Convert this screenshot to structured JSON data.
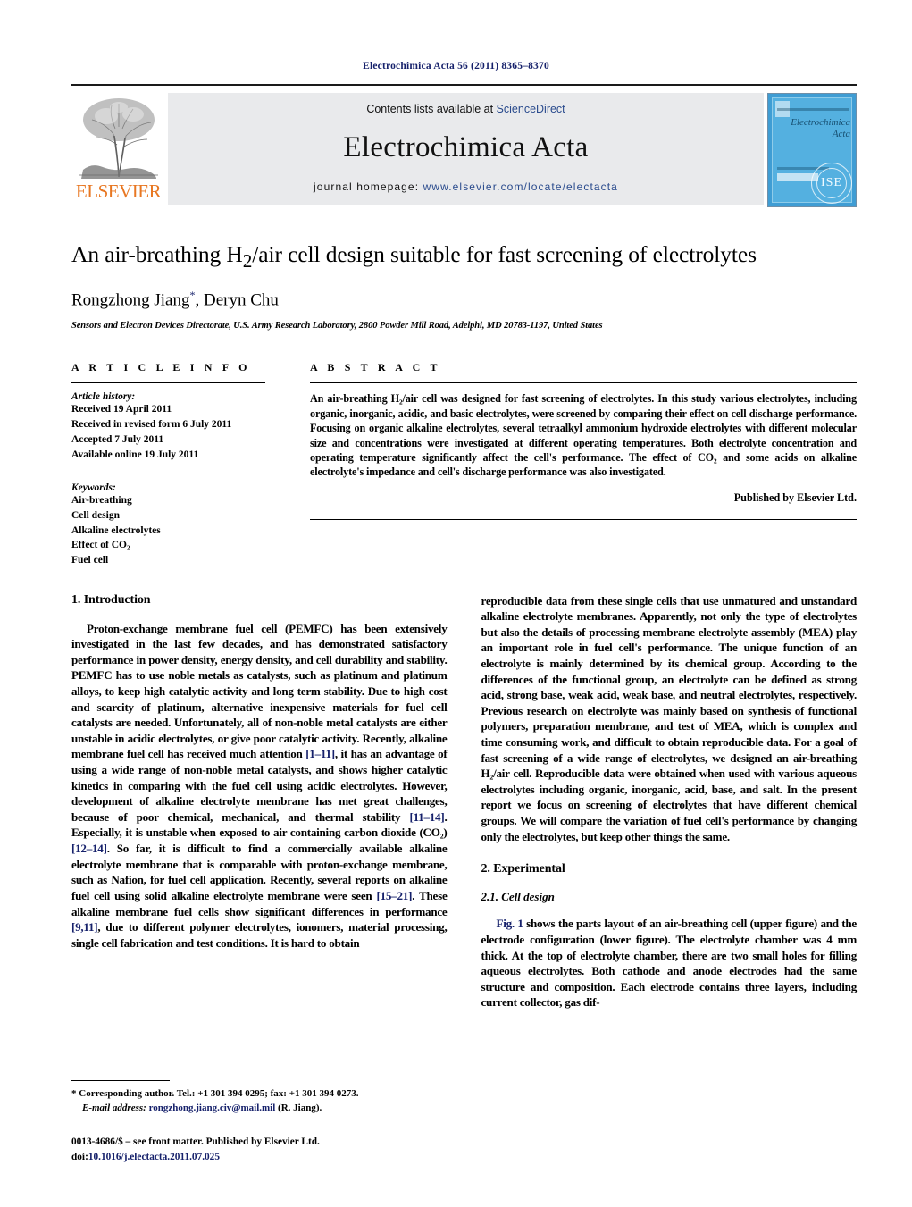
{
  "running_head": "Electrochimica Acta 56 (2011) 8365–8370",
  "masthead": {
    "publisher_name": "ELSEVIER",
    "contents_prefix": "Contents lists available at ",
    "contents_link": "ScienceDirect",
    "journal_name": "Electrochimica Acta",
    "homepage_prefix": "journal homepage: ",
    "homepage_url": "www.elsevier.com/locate/electacta",
    "cover_title": "Electrochimica Acta",
    "cover_seal_text": "ISE"
  },
  "article": {
    "title_part1": "An air-breathing H",
    "title_sub": "2",
    "title_part2": "/air cell design suitable for fast screening of electrolytes",
    "authors": "Rongzhong Jiang",
    "authors_sep": ", Deryn Chu",
    "corresponding_marker": "*",
    "affiliation": "Sensors and Electron Devices Directorate, U.S. Army Research Laboratory, 2800 Powder Mill Road, Adelphi, MD 20783-1197, United States"
  },
  "article_info": {
    "heading": "A R T I C L E    I N F O",
    "history_label": "Article history:",
    "history": [
      "Received 19 April 2011",
      "Received in revised form 6 July 2011",
      "Accepted 7 July 2011",
      "Available online 19 July 2011"
    ],
    "keywords_label": "Keywords:",
    "keywords": [
      "Air-breathing",
      "Cell design",
      "Alkaline electrolytes",
      "Effect of CO₂",
      "Fuel cell"
    ]
  },
  "abstract": {
    "heading": "A B S T R A C T",
    "text": "An air-breathing H₂/air cell was designed for fast screening of electrolytes. In this study various electrolytes, including organic, inorganic, acidic, and basic electrolytes, were screened by comparing their effect on cell discharge performance. Focusing on organic alkaline electrolytes, several tetraalkyl ammonium hydroxide electrolytes with different molecular size and concentrations were investigated at different operating temperatures. Both electrolyte concentration and operating temperature significantly affect the cell's performance. The effect of CO₂ and some acids on alkaline electrolyte's impedance and cell's discharge performance was also investigated.",
    "published_by": "Published by Elsevier Ltd."
  },
  "body": {
    "intro_heading": "1.  Introduction",
    "intro_p1_a": "Proton-exchange membrane fuel cell (PEMFC) has been extensively investigated in the last few decades, and has demonstrated satisfactory performance in power density, energy density, and cell durability and stability. PEMFC has to use noble metals as catalysts, such as platinum and platinum alloys, to keep high catalytic activity and long term stability. Due to high cost and scarcity of platinum, alternative inexpensive materials for fuel cell catalysts are needed. Unfortunately, all of non-noble metal catalysts are either unstable in acidic electrolytes, or give poor catalytic activity. Recently, alkaline membrane fuel cell has received much attention ",
    "ref1": "[1–11]",
    "intro_p1_b": ", it has an advantage of using a wide range of non-noble metal catalysts, and shows higher catalytic kinetics in comparing with the fuel cell using acidic electrolytes. However, development of alkaline electrolyte membrane has met great challenges, because of poor chemical, mechanical, and thermal stability ",
    "ref2": "[11–14]",
    "intro_p1_c": ". Especially, it is unstable when exposed to air containing carbon dioxide (CO₂) ",
    "ref3": "[12–14]",
    "intro_p1_d": ". So far, it is difficult to find a commercially available alkaline electrolyte membrane that is comparable with proton-exchange membrane, such as Nafion, for fuel cell application. Recently, several reports on alkaline fuel cell using solid alkaline electrolyte membrane were seen ",
    "ref4": "[15–21]",
    "intro_p1_e": ". These alkaline membrane fuel cells show significant differences in performance ",
    "ref5": "[9,11]",
    "intro_p1_f": ", due to different polymer electrolytes, ionomers, material processing, single cell fabrication and test conditions. It is hard to obtain",
    "intro_p1_cont": "reproducible data from these single cells that use unmatured and unstandard alkaline electrolyte membranes. Apparently, not only the type of electrolytes but also the details of processing membrane electrolyte assembly (MEA) play an important role in fuel cell's performance. The unique function of an electrolyte is mainly determined by its chemical group. According to the differences of the functional group, an electrolyte can be defined as strong acid, strong base, weak acid, weak base, and neutral electrolytes, respectively. Previous research on electrolyte was mainly based on synthesis of functional polymers, preparation membrane, and test of MEA, which is complex and time consuming work, and difficult to obtain reproducible data. For a goal of fast screening of a wide range of electrolytes, we designed an air-breathing H₂/air cell. Reproducible data were obtained when used with various aqueous electrolytes including organic, inorganic, acid, base, and salt. In the present report we focus on screening of electrolytes that have different chemical groups. We will compare the variation of fuel cell's performance by changing only the electrolytes, but keep other things the same.",
    "exp_heading": "2.  Experimental",
    "exp_sub": "2.1.  Cell design",
    "exp_fig_ref": "Fig. 1",
    "exp_p1": " shows the parts layout of an air-breathing cell (upper figure) and the electrode configuration (lower figure). The electrolyte chamber was 4 mm thick. At the top of electrolyte chamber, there are two small holes for filling aqueous electrolytes. Both cathode and anode electrodes had the same structure and composition. Each electrode contains three layers, including current collector, gas dif-"
  },
  "footnote": {
    "corresponding": "* Corresponding author. Tel.: +1 301 394 0295; fax: +1 301 394 0273.",
    "email_label": "E-mail address:",
    "email": "rongzhong.jiang.civ@mail.mil",
    "email_suffix": " (R. Jiang).",
    "issn": "0013-4686/$ – see front matter. Published by Elsevier Ltd.",
    "doi_label": "doi:",
    "doi": "10.1016/j.electacta.2011.07.025"
  },
  "colors": {
    "link_blue": "#2a4b8d",
    "ref_blue": "#16216b",
    "elsevier_orange": "#e87722",
    "band_gray": "#e9eaec",
    "cover_blue": "#54b0e0"
  }
}
